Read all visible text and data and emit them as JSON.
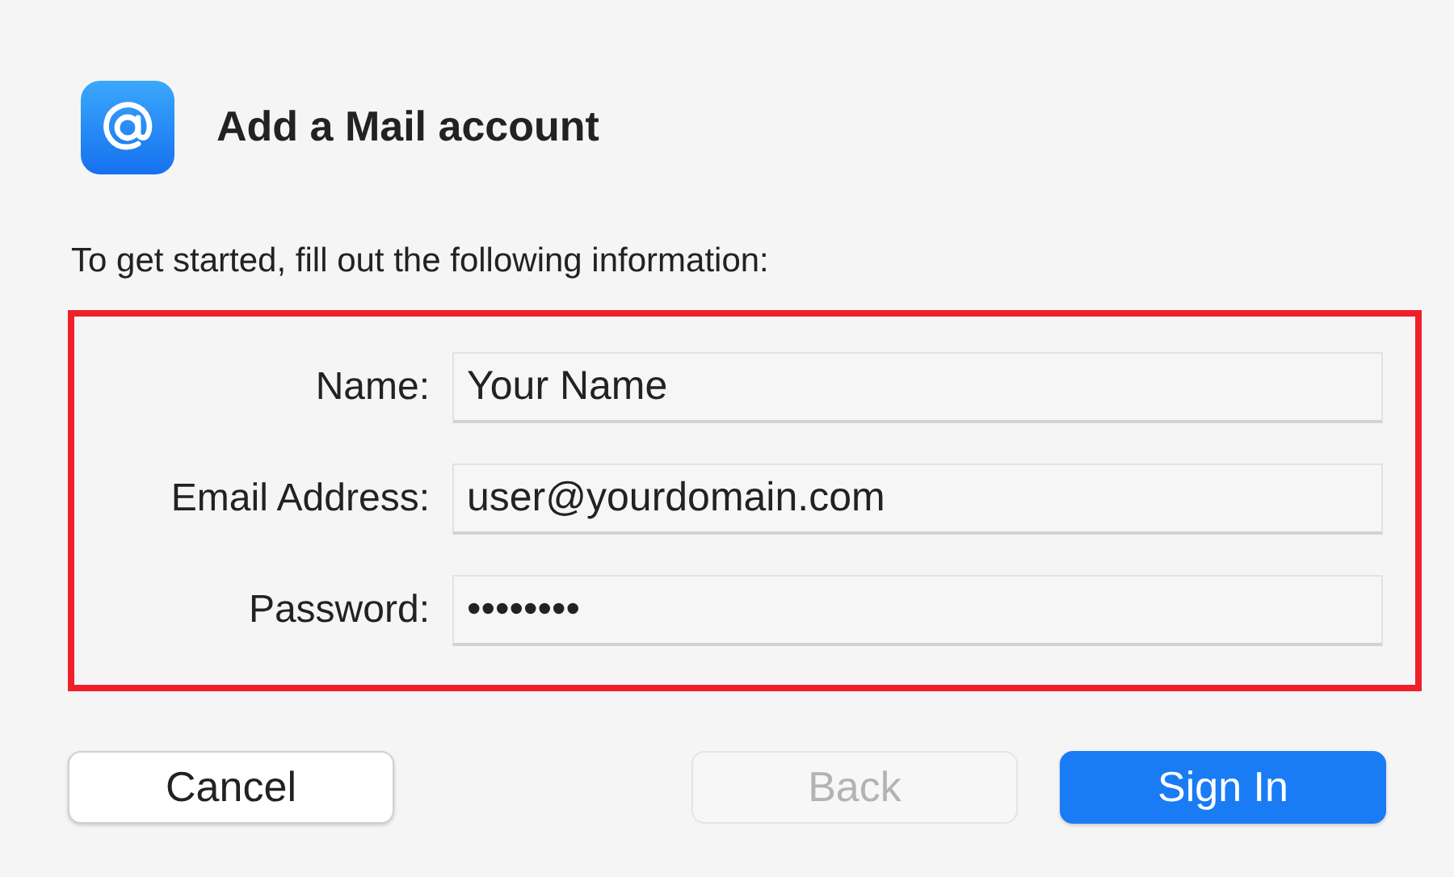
{
  "dialog": {
    "title": "Add a Mail account",
    "instructions": "To get started, fill out the following information:"
  },
  "fields": [
    {
      "label": "Name:",
      "value": "Your Name"
    },
    {
      "label": "Email Address:",
      "value": "user@yourdomain.com"
    },
    {
      "label": "Password:",
      "value": "••••••••"
    }
  ],
  "buttons": [
    {
      "label": "Cancel",
      "disabled": false,
      "default": false
    },
    {
      "label": "Back",
      "disabled": true,
      "default": false
    },
    {
      "label": "Sign In",
      "disabled": false,
      "default": true
    }
  ]
}
